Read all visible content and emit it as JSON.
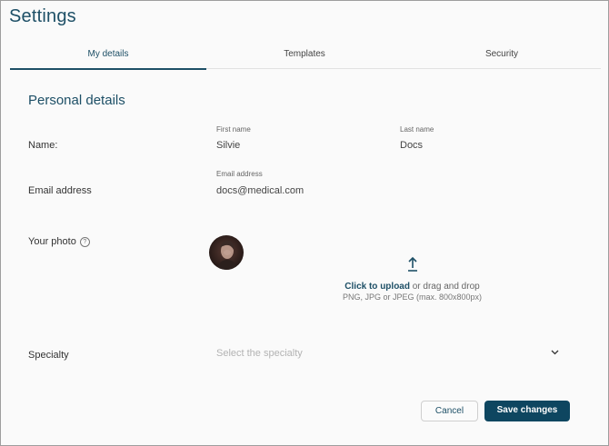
{
  "page": {
    "title": "Settings"
  },
  "tabs": [
    {
      "label": "My details",
      "active": true
    },
    {
      "label": "Templates",
      "active": false
    },
    {
      "label": "Security",
      "active": false
    }
  ],
  "personal": {
    "section_title": "Personal details",
    "name_label": "Name:",
    "first_name": {
      "label": "First name",
      "value": "Silvie"
    },
    "last_name": {
      "label": "Last name",
      "value": "Docs"
    },
    "email_row_label": "Email address",
    "email": {
      "label": "Email address",
      "value": "docs@medical.com"
    },
    "photo_label": "Your photo",
    "help_icon": "question-circle-icon",
    "upload": {
      "icon": "upload-arrow-icon",
      "link_text": "Click to upload",
      "rest_text": " or drag and drop",
      "hint": "PNG, JPG or JPEG (max. 800x800px)"
    },
    "specialty_label": "Specialty",
    "specialty_placeholder": "Select the specialty"
  },
  "actions": {
    "cancel": "Cancel",
    "save": "Save changes"
  },
  "colors": {
    "accent": "#1d4f66",
    "primary_button": "#0e4660",
    "placeholder": "#b3b3b3"
  }
}
